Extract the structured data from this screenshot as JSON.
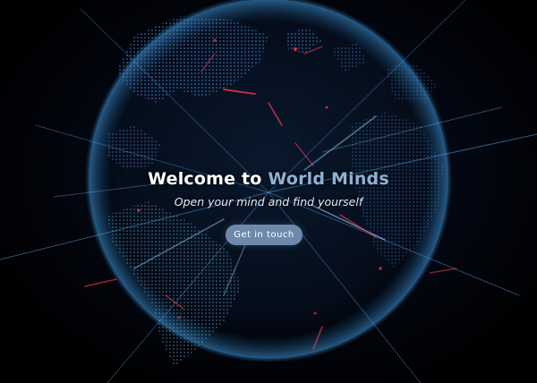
{
  "hero": {
    "title_prefix": "Welcome to ",
    "title_accent": "World Minds",
    "subtitle": "Open your mind and find yourself",
    "cta_label": "Get in touch"
  },
  "colors": {
    "background": "#000000",
    "accent_text": "#8fb1d4",
    "button": "#6d8aad",
    "globe_glow": "#1f6ea8",
    "streak_red": "#ff3b4e",
    "streak_blue": "#5fb4ff"
  }
}
